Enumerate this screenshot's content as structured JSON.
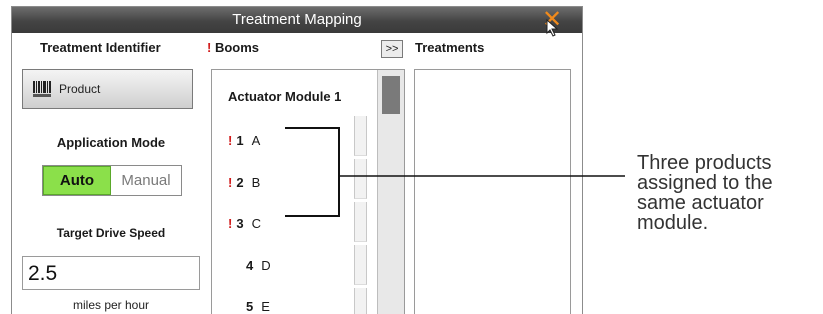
{
  "window": {
    "title": "Treatment Mapping",
    "close_icon": "close-x-icon",
    "accent_color": "#f08a1c"
  },
  "identifier": {
    "heading": "Treatment Identifier",
    "product_button_label": "Product",
    "product_icon": "barcode-icon"
  },
  "application_mode": {
    "label": "Application Mode",
    "options": [
      "Auto",
      "Manual"
    ],
    "selected": "Auto",
    "selected_color": "#8be04a"
  },
  "drive_speed": {
    "label": "Target Drive Speed",
    "value": "2.5",
    "units": "miles per hour"
  },
  "booms": {
    "heading_mark": "!",
    "heading": "Booms",
    "module_title": "Actuator Module 1",
    "rows": [
      {
        "warn": "!",
        "num": "1",
        "name": "A"
      },
      {
        "warn": "!",
        "num": "2",
        "name": "B"
      },
      {
        "warn": "!",
        "num": "3",
        "name": "C"
      },
      {
        "warn": "",
        "num": "4",
        "name": "D"
      },
      {
        "warn": "",
        "num": "5",
        "name": "E"
      }
    ],
    "warn_color": "#d11c1c"
  },
  "expand_button": ">>",
  "treatments": {
    "heading": "Treatments"
  },
  "callout": {
    "text": "Three products assigned to the same actuator module."
  }
}
